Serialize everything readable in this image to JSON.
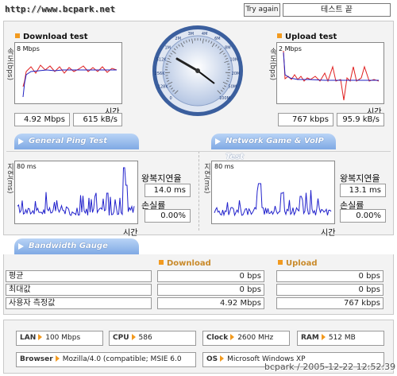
{
  "header": {
    "url": "http://www.bcpark.net",
    "try_again": "Try again",
    "status": "테스트 끝"
  },
  "download": {
    "title": "Download test",
    "max_label": "8 Mbps",
    "y_axis": "속도(bps)",
    "x_axis": "시간",
    "mbps": "4.92 Mbps",
    "kbs": "615 kB/s"
  },
  "upload": {
    "title": "Upload test",
    "max_label": "2 Mbps",
    "y_axis": "속도(bps)",
    "x_axis": "시간",
    "kbps": "767 kbps",
    "kbs": "95.9 kB/s"
  },
  "gauge": {
    "ticks": [
      "0",
      "128K",
      "256K",
      "512K",
      "1M",
      "2M",
      "3M",
      "4M",
      "6M",
      "8M",
      "10M",
      "20M",
      "50M",
      "100M"
    ]
  },
  "tabs": {
    "ping": "General Ping Test",
    "game": "Network Game & VoIP Test",
    "bandwidth": "Bandwidth Gauge"
  },
  "ping": {
    "max_label": "80 ms",
    "y_axis": "지연(ms)",
    "x_axis": "시간",
    "rtt_label": "왕복지연율",
    "rtt": "14.0 ms",
    "loss_label": "손실률",
    "loss": "0.00%"
  },
  "game": {
    "max_label": "80 ms",
    "y_axis": "지연(ms)",
    "x_axis": "시간",
    "rtt_label": "왕복지연율",
    "rtt": "13.1 ms",
    "loss_label": "손실률",
    "loss": "0.00%"
  },
  "bandwidth": {
    "download_header": "Download",
    "upload_header": "Upload",
    "rows": [
      {
        "label": "평균",
        "dl": "0 bps",
        "ul": "0 bps"
      },
      {
        "label": "최대값",
        "dl": "0 bps",
        "ul": "0 bps"
      },
      {
        "label": "사용자 측정값",
        "dl": "4.92 Mbps",
        "ul": "767 kbps"
      }
    ]
  },
  "system": {
    "lan_key": "LAN",
    "lan": "100 Mbps",
    "cpu_key": "CPU",
    "cpu": "586",
    "clock_key": "Clock",
    "clock": "2600 MHz",
    "ram_key": "RAM",
    "ram": "512 MB",
    "browser_key": "Browser",
    "browser": "Mozilla/4.0 (compatible; MSIE 6.0",
    "os_key": "OS",
    "os": "Microsoft Windows XP"
  },
  "footer": {
    "stamp": "bcpark / 2005-12-22 12:52:39"
  },
  "colors": {
    "accent": "#f29a1f",
    "tab_blue": "#7fa9e4",
    "download_line": "#e02020",
    "mean_line": "#2020c0",
    "ping_line": "#2222cc"
  }
}
